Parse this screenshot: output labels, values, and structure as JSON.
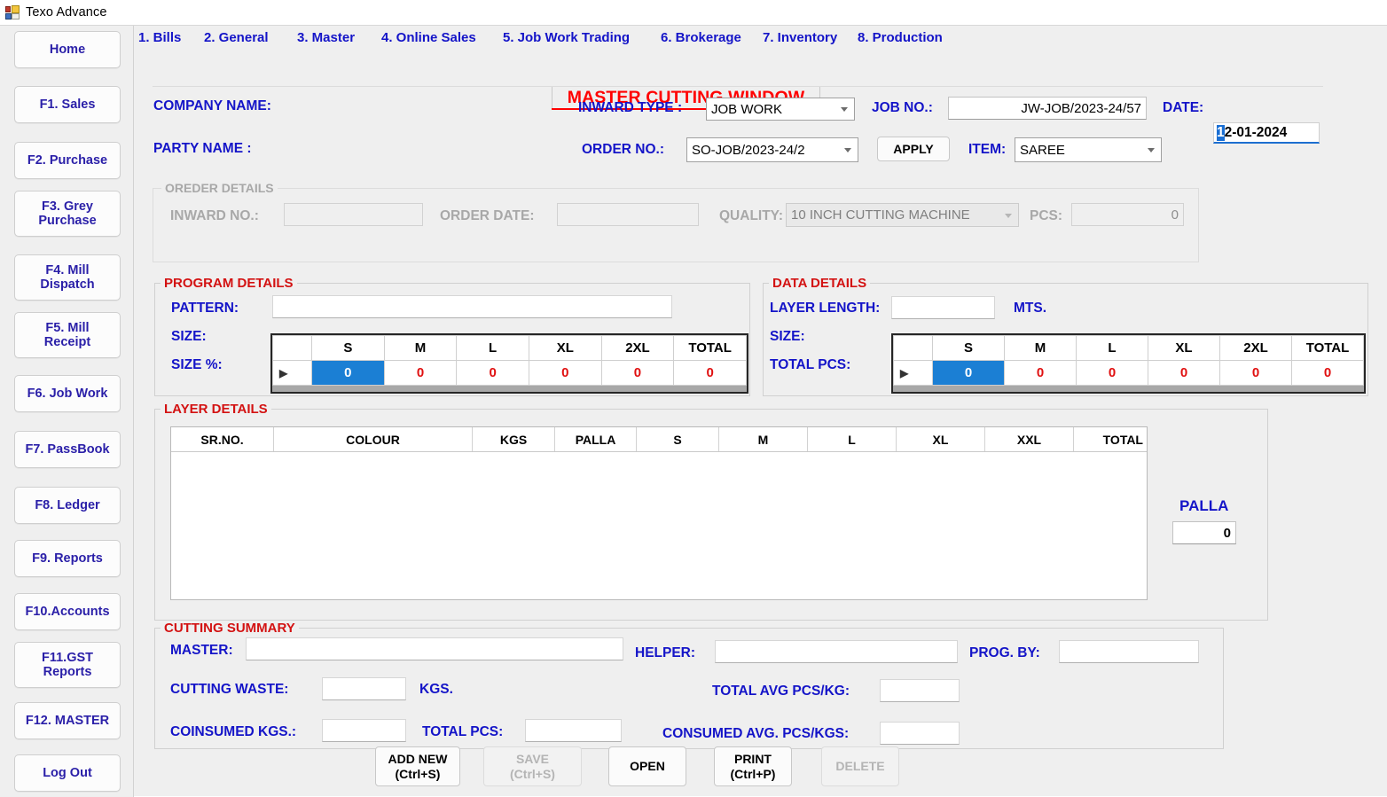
{
  "window": {
    "title": "Texo Advance",
    "icon": "vs-form-icon"
  },
  "sidebar": {
    "items": [
      {
        "label": "Home",
        "name": "home"
      },
      {
        "label": "F1. Sales",
        "name": "f1-sales"
      },
      {
        "label": "F2. Purchase",
        "name": "f2-purchase"
      },
      {
        "label": "F3. Grey\nPurchase",
        "name": "f3-grey-purchase"
      },
      {
        "label": "F4. Mill\nDispatch",
        "name": "f4-mill-dispatch"
      },
      {
        "label": "F5. Mill\nReceipt",
        "name": "f5-mill-receipt"
      },
      {
        "label": "F6. Job Work",
        "name": "f6-job-work"
      },
      {
        "label": "F7. PassBook",
        "name": "f7-passbook"
      },
      {
        "label": "F8. Ledger",
        "name": "f8-ledger"
      },
      {
        "label": "F9. Reports",
        "name": "f9-reports"
      },
      {
        "label": "F10.Accounts",
        "name": "f10-accounts"
      },
      {
        "label": "F11.GST\nReports",
        "name": "f11-gst-reports"
      },
      {
        "label": "F12. MASTER",
        "name": "f12-master"
      },
      {
        "label": "Log Out",
        "name": "log-out"
      }
    ]
  },
  "menu": {
    "items": [
      {
        "label": "1. Bills"
      },
      {
        "label": "2. General"
      },
      {
        "label": "3. Master"
      },
      {
        "label": "4. Online Sales"
      },
      {
        "label": "5. Job Work Trading"
      },
      {
        "label": "6. Brokerage"
      },
      {
        "label": "7. Inventory"
      },
      {
        "label": "8. Production"
      }
    ]
  },
  "page": {
    "title": "MASTER CUTTING WINDOW",
    "title_color": "#ff0000"
  },
  "header": {
    "company_name_label": "COMPANY NAME:",
    "company_name_value": "",
    "party_name_label": "PARTY NAME :",
    "party_name_value": "",
    "inward_type_label": "INWARD TYPE :",
    "inward_type_value": "JOB WORK",
    "job_no_label": "JOB NO.:",
    "job_no_value": "JW-JOB/2023-24/57",
    "date_label": "DATE:",
    "date_value_selected": "1",
    "date_value_rest": "2-01-2024",
    "order_no_label": "ORDER NO.:",
    "order_no_value": "SO-JOB/2023-24/2",
    "apply_label": "APPLY",
    "item_label": "ITEM:",
    "item_value": "SAREE"
  },
  "order_details": {
    "group_label": "OREDER DETAILS",
    "disabled": true,
    "inward_no_label": "INWARD NO.:",
    "inward_no_value": "",
    "order_date_label": "ORDER DATE:",
    "order_date_value": "",
    "quality_label": "QUALITY:",
    "quality_value": "10 INCH CUTTING MACHINE",
    "pcs_label": "PCS:",
    "pcs_value": "0"
  },
  "program_details": {
    "group_label": "PROGRAM DETAILS",
    "pattern_label": "PATTERN:",
    "pattern_value": "",
    "size_label": "SIZE:",
    "size_pct_label": "SIZE %:",
    "columns": [
      "",
      "S",
      "M",
      "L",
      "XL",
      "2XL",
      "TOTAL"
    ],
    "row": [
      "▶",
      "0",
      "0",
      "0",
      "0",
      "0",
      "0"
    ],
    "selected_column": "S"
  },
  "data_details": {
    "group_label": "DATA DETAILS",
    "layer_length_label": "LAYER LENGTH:",
    "layer_length_value": "",
    "mts_label": "MTS.",
    "size_label": "SIZE:",
    "total_pcs_label": "TOTAL PCS:",
    "columns": [
      "",
      "S",
      "M",
      "L",
      "XL",
      "2XL",
      "TOTAL"
    ],
    "row": [
      "▶",
      "0",
      "0",
      "0",
      "0",
      "0",
      "0"
    ],
    "selected_column": "S"
  },
  "layer_details": {
    "group_label": "LAYER DETAILS",
    "columns": [
      "SR.NO.",
      "COLOUR",
      "KGS",
      "PALLA",
      "S",
      "M",
      "L",
      "XL",
      "XXL",
      "TOTAL"
    ],
    "rows": [],
    "palla_label": "PALLA",
    "palla_value": "0"
  },
  "cutting_summary": {
    "group_label": "CUTTING SUMMARY",
    "master_label": "MASTER:",
    "master_value": "",
    "helper_label": "HELPER:",
    "helper_value": "",
    "prog_by_label": "PROG. BY:",
    "prog_by_value": "",
    "cutting_waste_label": "CUTTING WASTE:",
    "cutting_waste_value": "",
    "kgs_label": "KGS.",
    "total_avg_label": "TOTAL AVG PCS/KG:",
    "total_avg_value": "",
    "coinsumed_kgs_label": "COINSUMED KGS.:",
    "coinsumed_kgs_value": "",
    "total_pcs_label": "TOTAL PCS:",
    "total_pcs_value": "",
    "consumed_avg_label": "CONSUMED AVG. PCS/KGS:",
    "consumed_avg_value": ""
  },
  "actions": {
    "add_new": "ADD NEW\n(Ctrl+S)",
    "save": "SAVE\n(Ctrl+S)",
    "open": "OPEN",
    "print": "PRINT\n(Ctrl+P)",
    "delete": "DELETE"
  }
}
